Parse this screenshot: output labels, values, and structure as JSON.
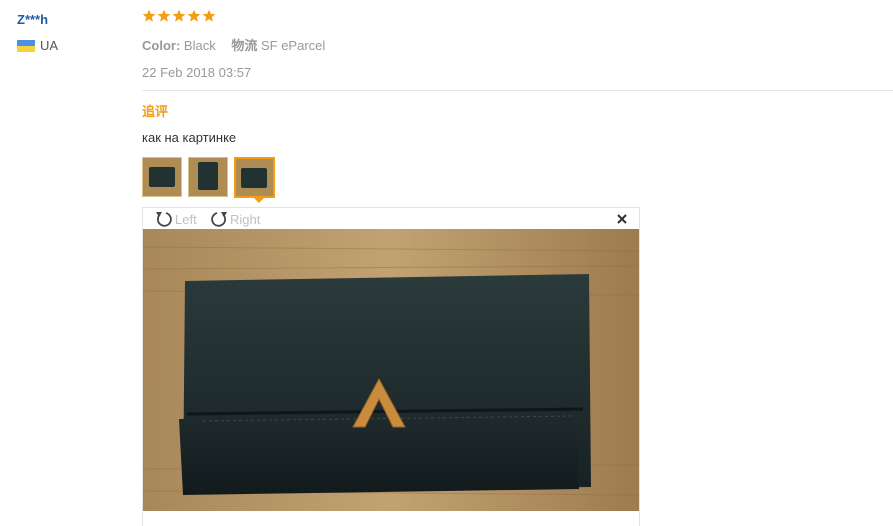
{
  "reviewer": {
    "name": "Z***h",
    "country_code": "UA",
    "flag_colors": [
      "#4d8ee6",
      "#f5d33b"
    ]
  },
  "review": {
    "rating": 5,
    "rating_max": 5,
    "star_color": "#f29d12",
    "attributes": [
      {
        "label": "Color:",
        "value": "Black"
      },
      {
        "label": "物流",
        "value": "SF eParcel"
      }
    ],
    "date": "22 Feb 2018 03:57",
    "followup_title": "追评",
    "feedback_text": "как на картинке",
    "thumbnails": [
      {
        "name": "wallet-photo-1",
        "active": false
      },
      {
        "name": "wallet-photo-2",
        "active": false
      },
      {
        "name": "wallet-photo-3",
        "active": true
      }
    ]
  },
  "viewer": {
    "rotate_left_label": "Left",
    "rotate_right_label": "Right",
    "close_icon": "close-icon",
    "photo_description_icon": "wallet-photo"
  }
}
